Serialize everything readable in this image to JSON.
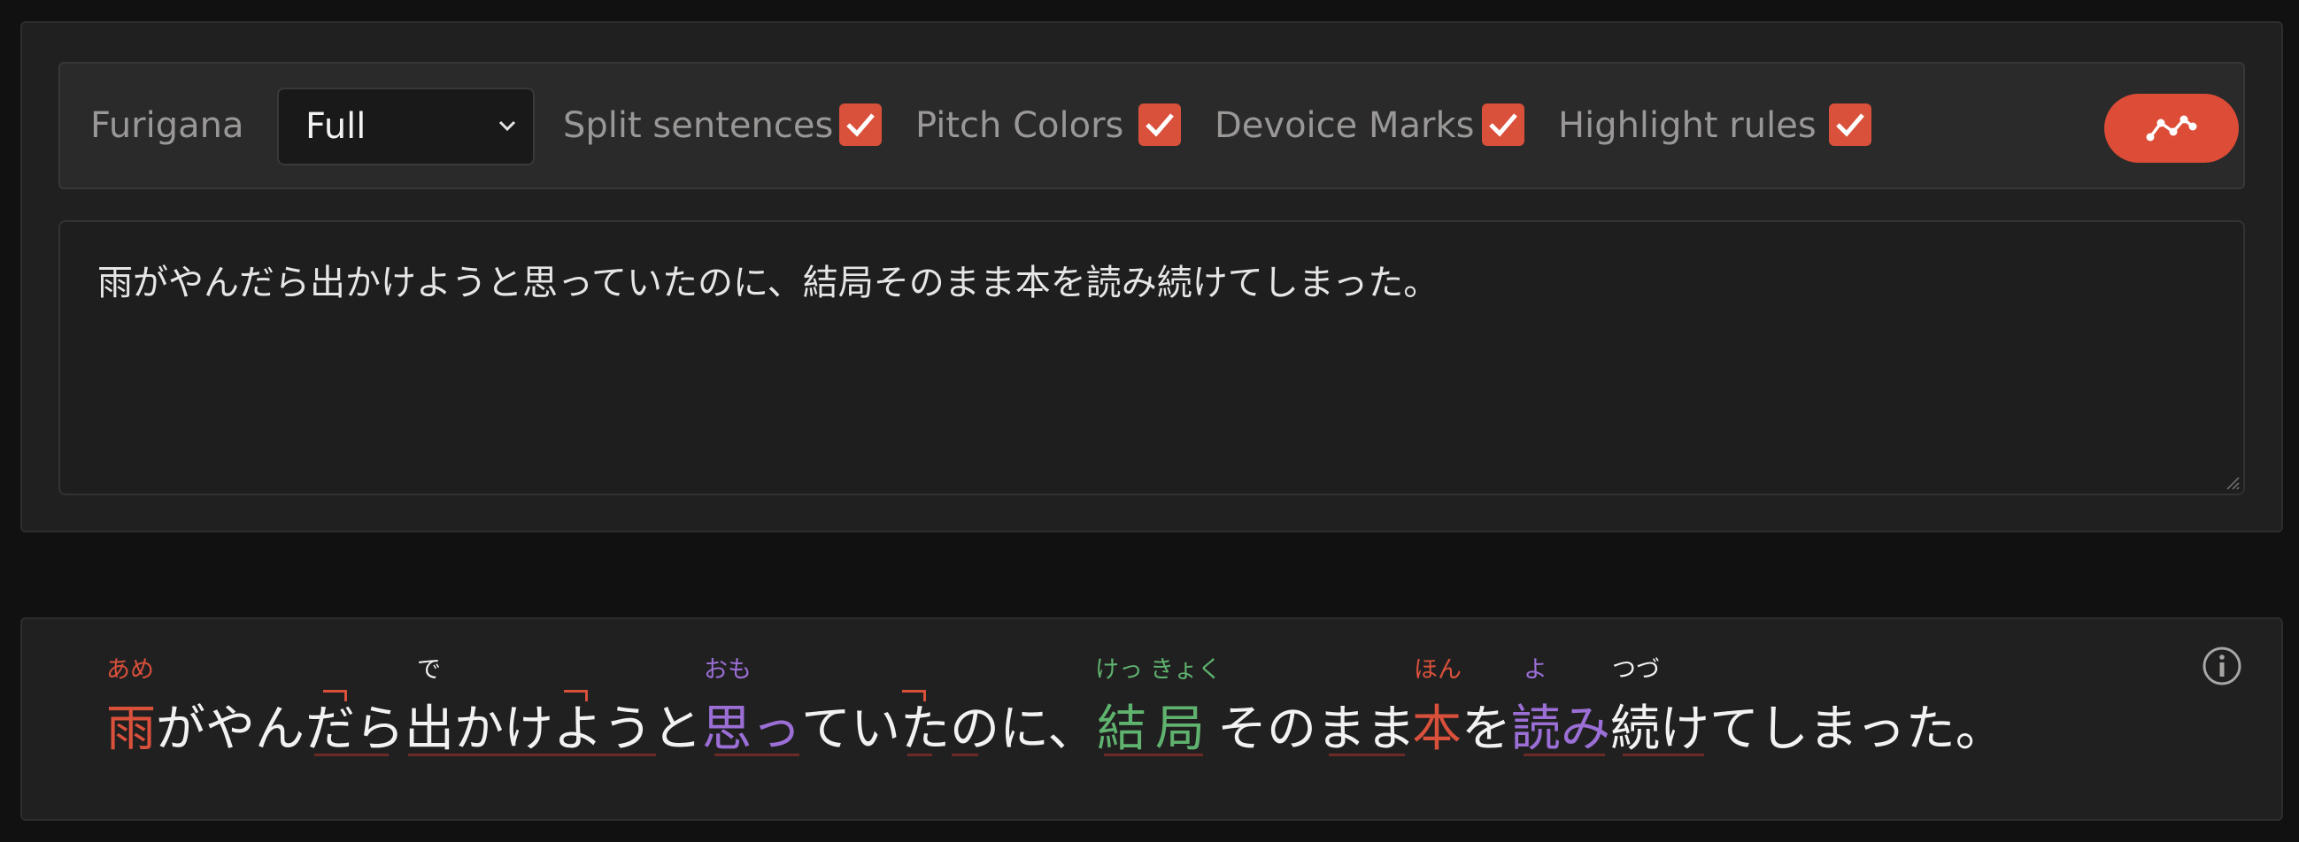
{
  "toolbar": {
    "furigana_label": "Furigana",
    "furigana_value": "Full",
    "split_label": "Split sentences",
    "split_checked": true,
    "pitch_label": "Pitch Colors",
    "pitch_checked": true,
    "devoice_label": "Devoice Marks",
    "devoice_checked": true,
    "highlight_label": "Highlight rules",
    "highlight_checked": true,
    "graph_button_icon": "graph-icon",
    "accent_color": "#dc4c36"
  },
  "input": {
    "text": "雨がやんだら出かけようと思っていたのに、結局そのまま本を読み続けてしまった。"
  },
  "output": {
    "info_icon": "info-icon",
    "segments": [
      {
        "text": "雨",
        "ruby": "あめ",
        "color": "red"
      },
      {
        "text": "がやん",
        "ruby": "",
        "color": "white"
      },
      {
        "text": "だら",
        "ruby": "",
        "color": "white"
      },
      {
        "text": "出",
        "ruby": "で",
        "color": "white"
      },
      {
        "text": "かけようと",
        "ruby": "",
        "color": "white"
      },
      {
        "text": "思",
        "ruby": "おも",
        "color": "purple"
      },
      {
        "text": "っ",
        "ruby": "",
        "color": "purple"
      },
      {
        "text": "ていたのに、",
        "ruby": "",
        "color": "white"
      },
      {
        "text": "結",
        "ruby": "けっ",
        "color": "green"
      },
      {
        "text": "局",
        "ruby": "きょく",
        "color": "green"
      },
      {
        "text": "そのまま",
        "ruby": "",
        "color": "white"
      },
      {
        "text": "本",
        "ruby": "ほん",
        "color": "red"
      },
      {
        "text": "を",
        "ruby": "",
        "color": "white"
      },
      {
        "text": "読",
        "ruby": "よ",
        "color": "purple"
      },
      {
        "text": "み",
        "ruby": "",
        "color": "purple"
      },
      {
        "text": "続",
        "ruby": "つづ",
        "color": "white"
      },
      {
        "text": "けてしまった。",
        "ruby": "",
        "color": "white"
      }
    ]
  }
}
